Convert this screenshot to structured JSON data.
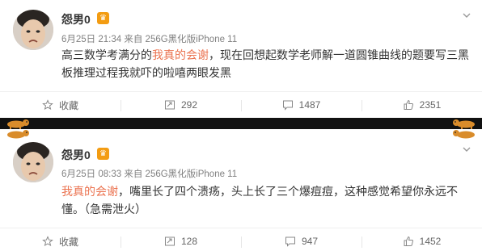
{
  "posts": [
    {
      "username": "怨男0",
      "badge": "♛",
      "meta": "6月25日 21:34 来自 256G黑化版iPhone 11",
      "text_highlight": "我真的会谢",
      "text_pre": "高三数学考满分的",
      "text_post": "，现在回想起数学老师解一道圆锥曲线的题要写三黑板推理过程我就吓的啦嘻两眼发黑",
      "actions": {
        "favorite": "收藏",
        "repost": "292",
        "comment": "1487",
        "like": "2351"
      }
    },
    {
      "username": "怨男0",
      "badge": "♛",
      "meta": "6月25日 08:33 来自 256G黑化版iPhone 11",
      "text_highlight": "我真的会谢",
      "text_pre": "",
      "text_post": "，嘴里长了四个溃疡，头上长了三个爆痘痘，这种感觉希望你永远不懂。（急需泄火）",
      "actions": {
        "favorite": "收藏",
        "repost": "128",
        "comment": "947",
        "like": "1452"
      }
    }
  ],
  "colors": {
    "highlight": "#eb7350",
    "meta": "#808080",
    "divider": "#111111",
    "badge": "#f39c12"
  },
  "icons": {
    "favorite": "star-icon",
    "repost": "repost-icon",
    "comment": "comment-icon",
    "like": "thumb-up-icon",
    "menu": "chevron-down-icon"
  }
}
